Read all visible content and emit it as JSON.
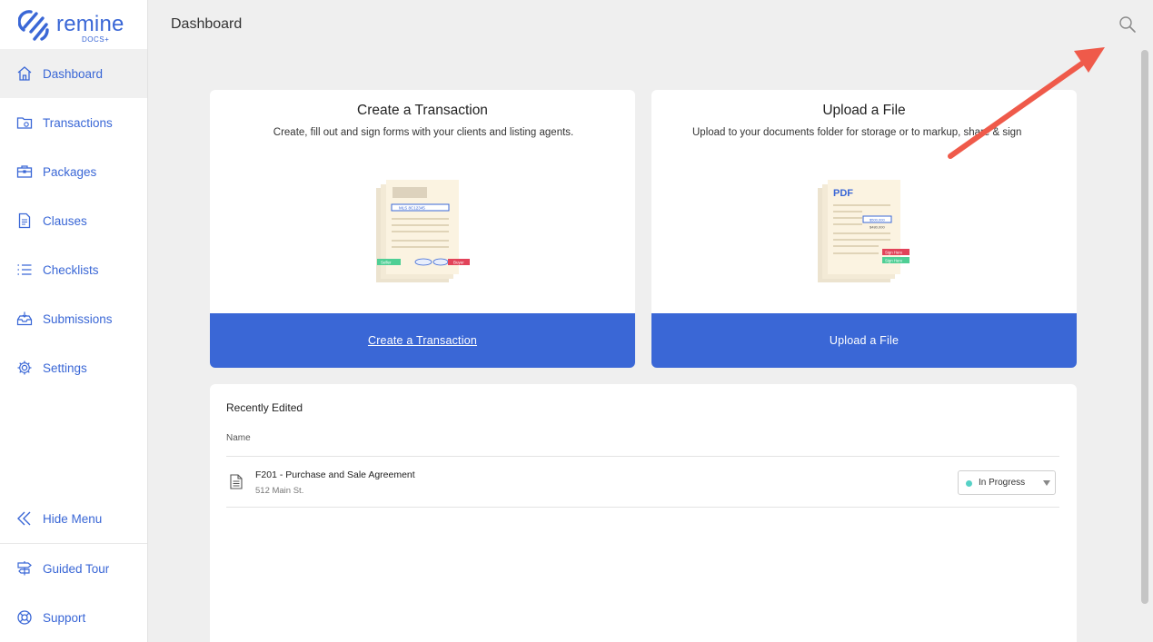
{
  "brand": {
    "name": "remine",
    "sub": "DOCS+",
    "color": "#3a67d6"
  },
  "header": {
    "title": "Dashboard",
    "search_icon": "search-icon"
  },
  "sidebar": {
    "items": [
      {
        "label": "Dashboard",
        "icon": "home-icon",
        "active": true
      },
      {
        "label": "Transactions",
        "icon": "folder-icon"
      },
      {
        "label": "Packages",
        "icon": "briefcase-icon"
      },
      {
        "label": "Clauses",
        "icon": "document-icon"
      },
      {
        "label": "Checklists",
        "icon": "list-icon"
      },
      {
        "label": "Submissions",
        "icon": "inbox-icon"
      },
      {
        "label": "Settings",
        "icon": "gear-icon"
      }
    ],
    "bottom": [
      {
        "label": "Hide Menu",
        "icon": "double-chevron-left-icon"
      },
      {
        "label": "Guided Tour",
        "icon": "signpost-icon"
      },
      {
        "label": "Support",
        "icon": "lifebuoy-icon"
      }
    ]
  },
  "cards": {
    "create": {
      "title": "Create a Transaction",
      "description": "Create, fill out and sign forms with your clients and listing agents.",
      "action": "Create a Transaction",
      "illustration": {
        "mls_label": "MLS 8C12345",
        "seller_tag": "Seller",
        "buyer_tag": "Buyer"
      }
    },
    "upload": {
      "title": "Upload a File",
      "description": "Upload to your documents folder for storage or to markup, share & sign",
      "action": "Upload a File",
      "illustration": {
        "pdf_label": "PDF",
        "price_1": "$500,000",
        "price_2": "$480,000",
        "sign_1": "Sign Here",
        "sign_2": "Sign Here"
      }
    }
  },
  "recent": {
    "title": "Recently Edited",
    "column": "Name",
    "rows": [
      {
        "name": "F201 - Purchase and Sale Agreement",
        "address": "512 Main St.",
        "status": "In Progress",
        "status_color": "#56d1c6"
      }
    ]
  },
  "colors": {
    "accent": "#3a67d6",
    "annotation": "#ef5a4a",
    "seller": "#4fcf95",
    "buyer": "#e2435a"
  }
}
